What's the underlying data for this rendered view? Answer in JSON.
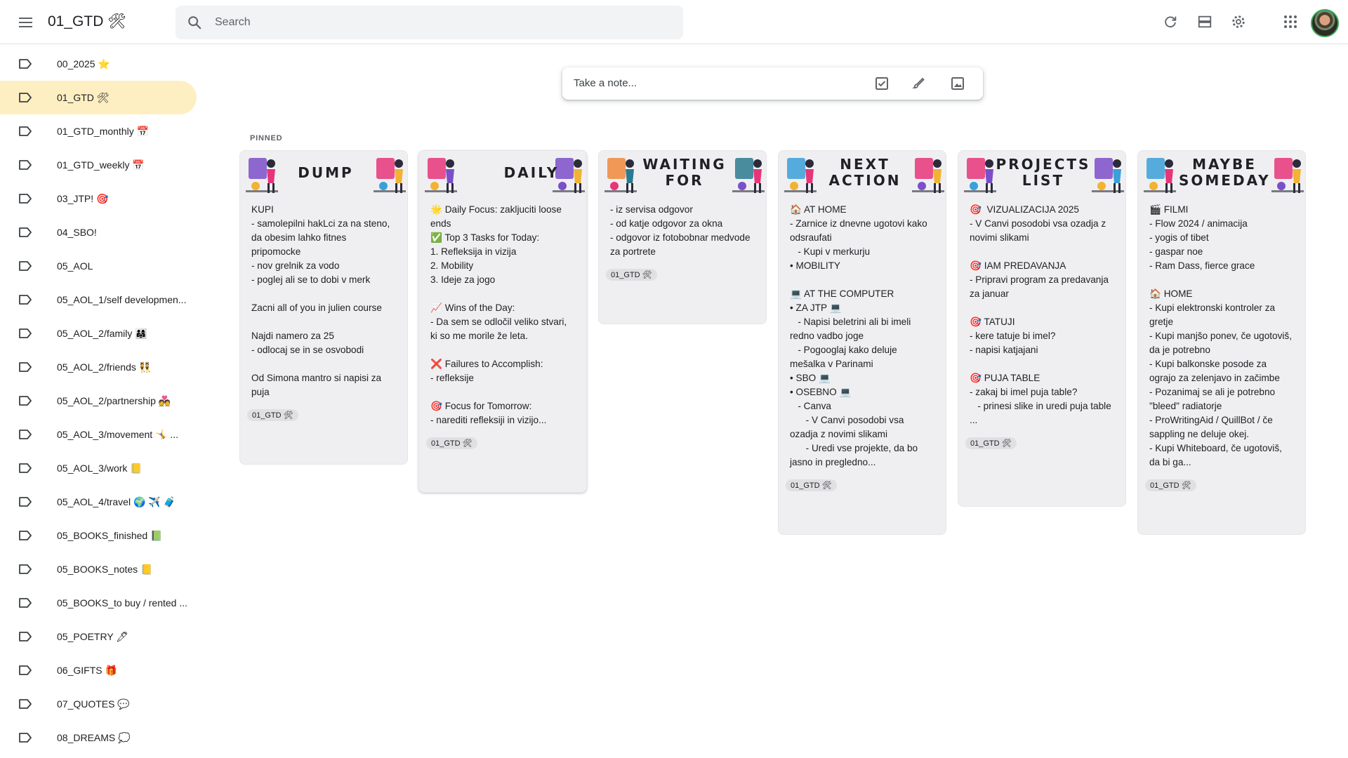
{
  "header": {
    "title": "01_GTD 🛠",
    "search_placeholder": "Search",
    "icons": [
      "menu-icon",
      "search-icon",
      "refresh-icon",
      "list-view-icon",
      "settings-icon",
      "apps-icon",
      "account-avatar"
    ]
  },
  "take_note": {
    "placeholder": "Take a note...",
    "icons": [
      "checkbox-icon",
      "brush-icon",
      "image-icon"
    ]
  },
  "section": {
    "pinned": "PINNED"
  },
  "sidebar": {
    "items": [
      {
        "label": "00_2025 ⭐"
      },
      {
        "label": "01_GTD 🛠"
      },
      {
        "label": "01_GTD_monthly 📅"
      },
      {
        "label": "01_GTD_weekly 📅"
      },
      {
        "label": "03_JTP! 🎯"
      },
      {
        "label": "04_SBO!"
      },
      {
        "label": "05_AOL"
      },
      {
        "label": "05_AOL_1/self developmen..."
      },
      {
        "label": "05_AOL_2/family 👨‍👩‍👧"
      },
      {
        "label": "05_AOL_2/friends 👯"
      },
      {
        "label": "05_AOL_2/partnership 💑"
      },
      {
        "label": "05_AOL_3/movement 🤸 ..."
      },
      {
        "label": "05_AOL_3/work 📒"
      },
      {
        "label": "05_AOL_4/travel 🌍 ✈️ 🧳"
      },
      {
        "label": "05_BOOKS_finished 📗"
      },
      {
        "label": "05_BOOKS_notes 📒"
      },
      {
        "label": "05_BOOKS_to buy / rented ..."
      },
      {
        "label": "05_POETRY 🖊"
      },
      {
        "label": "06_GIFTS 🎁"
      },
      {
        "label": "07_QUOTES 💬"
      },
      {
        "label": "08_DREAMS 💭"
      }
    ],
    "active_index": 1,
    "active_color": "#feefc3"
  },
  "notes": [
    {
      "title": "DUMP",
      "body": "KUPI\n- samolepilni hakLci za na steno, da obesim lahko fitnes pripomocke\n- nov grelnik za vodo\n- poglej ali se to dobi v merk\n\nZacni all of you in julien course\n\nNajdi namero za 25\n- odlocaj se in se osvobodi\n\nOd Simona mantro si napisi za puja",
      "label": "01_GTD 🛠"
    },
    {
      "title": "DAILY",
      "body": "🌟 Daily Focus: zakljuciti loose ends\n✅ Top 3 Tasks for Today:\n1. Refleksija in vizija\n2. Mobility\n3. Ideje za jogo\n\n📈 Wins of the Day:\n- Da sem se odločil veliko stvari, ki so me morile že leta.\n\n❌ Failures to Accomplish:\n- refleksije\n\n🎯 Focus for Tomorrow:\n- narediti refleksiji in vizijo...",
      "label": "01_GTD 🛠"
    },
    {
      "title": "WAITING FOR",
      "body": "- iz servisa odgovor\n- od katje odgovor za okna\n- odgovor iz fotobobnar medvode za portrete",
      "label": "01_GTD 🛠"
    },
    {
      "title": "NEXT ACTION",
      "body": "🏠 AT HOME\n- Zarnice iz dnevne ugotovi kako odsraufati\n   - Kupi v merkurju\n• MOBILITY\n\n💻 AT THE COMPUTER\n• ZA JTP 💻\n   - Napisi beletrini ali bi imeli redno vadbo joge\n   - Pogooglaj kako deluje mešalka v Parinami\n• SBO 💻\n• OSEBNO 💻\n   - Canva\n      - V Canvi posodobi vsa ozadja z novimi slikami\n      - Uredi vse projekte, da bo jasno in pregledno...",
      "label": "01_GTD 🛠"
    },
    {
      "title": "PROJECTS LIST",
      "body": "🎯  VIZUALIZACIJA 2025\n- V Canvi posodobi vsa ozadja z novimi slikami\n\n🎯 IAM PREDAVANJA\n- Pripravi program za predavanja za januar\n\n🎯 TATUJI\n- kere tatuje bi imel?\n- napisi katjajani\n\n🎯 PUJA TABLE\n- zakaj bi imel puja table?\n   - prinesi slike in uredi puja table\n...",
      "label": "01_GTD 🛠"
    },
    {
      "title": "MAYBE SOMEDAY",
      "body": "🎬 FILMI\n- Flow 2024 / animacija\n- yogis of tibet\n- gaspar noe\n- Ram Dass, fierce grace\n\n🏠 HOME\n- Kupi elektronski kontroler za gretje\n- Kupi manjšo ponev, če ugotoviš, da je potrebno\n- Kupi balkonske posode za ograjo za zelenjavo in začimbe\n- Pozanimaj se ali je potrebno \"bleed\" radiatorje\n- ProWritingAid / QuillBot / če sappling ne deluje okej.\n- Kupi Whiteboard, če ugotoviš, da bi ga...",
      "label": "01_GTD 🛠"
    }
  ]
}
